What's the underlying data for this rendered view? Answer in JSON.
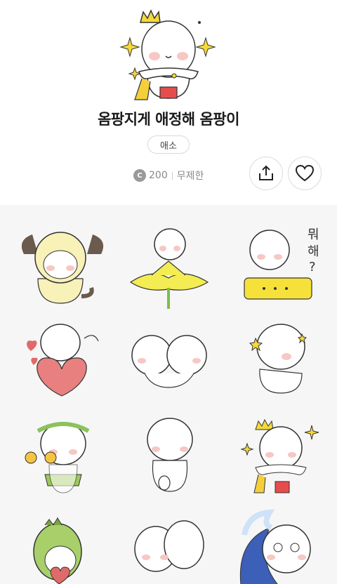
{
  "header": {
    "back_icon": "chevron-left-icon",
    "gift_icon": "gift-icon",
    "close_icon": "close-icon"
  },
  "pack": {
    "title": "옴팡지게 애정해 옴팡이",
    "author": "애소",
    "price": "200",
    "coin_symbol": "C",
    "duration": "무제한"
  },
  "actions": {
    "share_icon": "share-icon",
    "like_icon": "heart-icon"
  },
  "stickers": [
    {
      "name": "puppy-hood-sticker"
    },
    {
      "name": "flower-sticker"
    },
    {
      "name": "speech-bubble-sticker",
      "text_line1": "뭐",
      "text_line2": "해",
      "text_line3": "?"
    },
    {
      "name": "heart-hug-sticker"
    },
    {
      "name": "hug-two-sticker"
    },
    {
      "name": "sitting-stars-sticker"
    },
    {
      "name": "hula-maracas-sticker"
    },
    {
      "name": "shy-back-sticker"
    },
    {
      "name": "king-crown-sticker"
    },
    {
      "name": "dino-heart-sticker"
    },
    {
      "name": "cuddle-sticker"
    },
    {
      "name": "wave-crying-sticker"
    }
  ],
  "colors": {
    "accent_yellow": "#f5e13a",
    "blush": "#f6c8c4",
    "grid_bg": "#f6f6f6",
    "heart_red": "#e06a6a"
  }
}
